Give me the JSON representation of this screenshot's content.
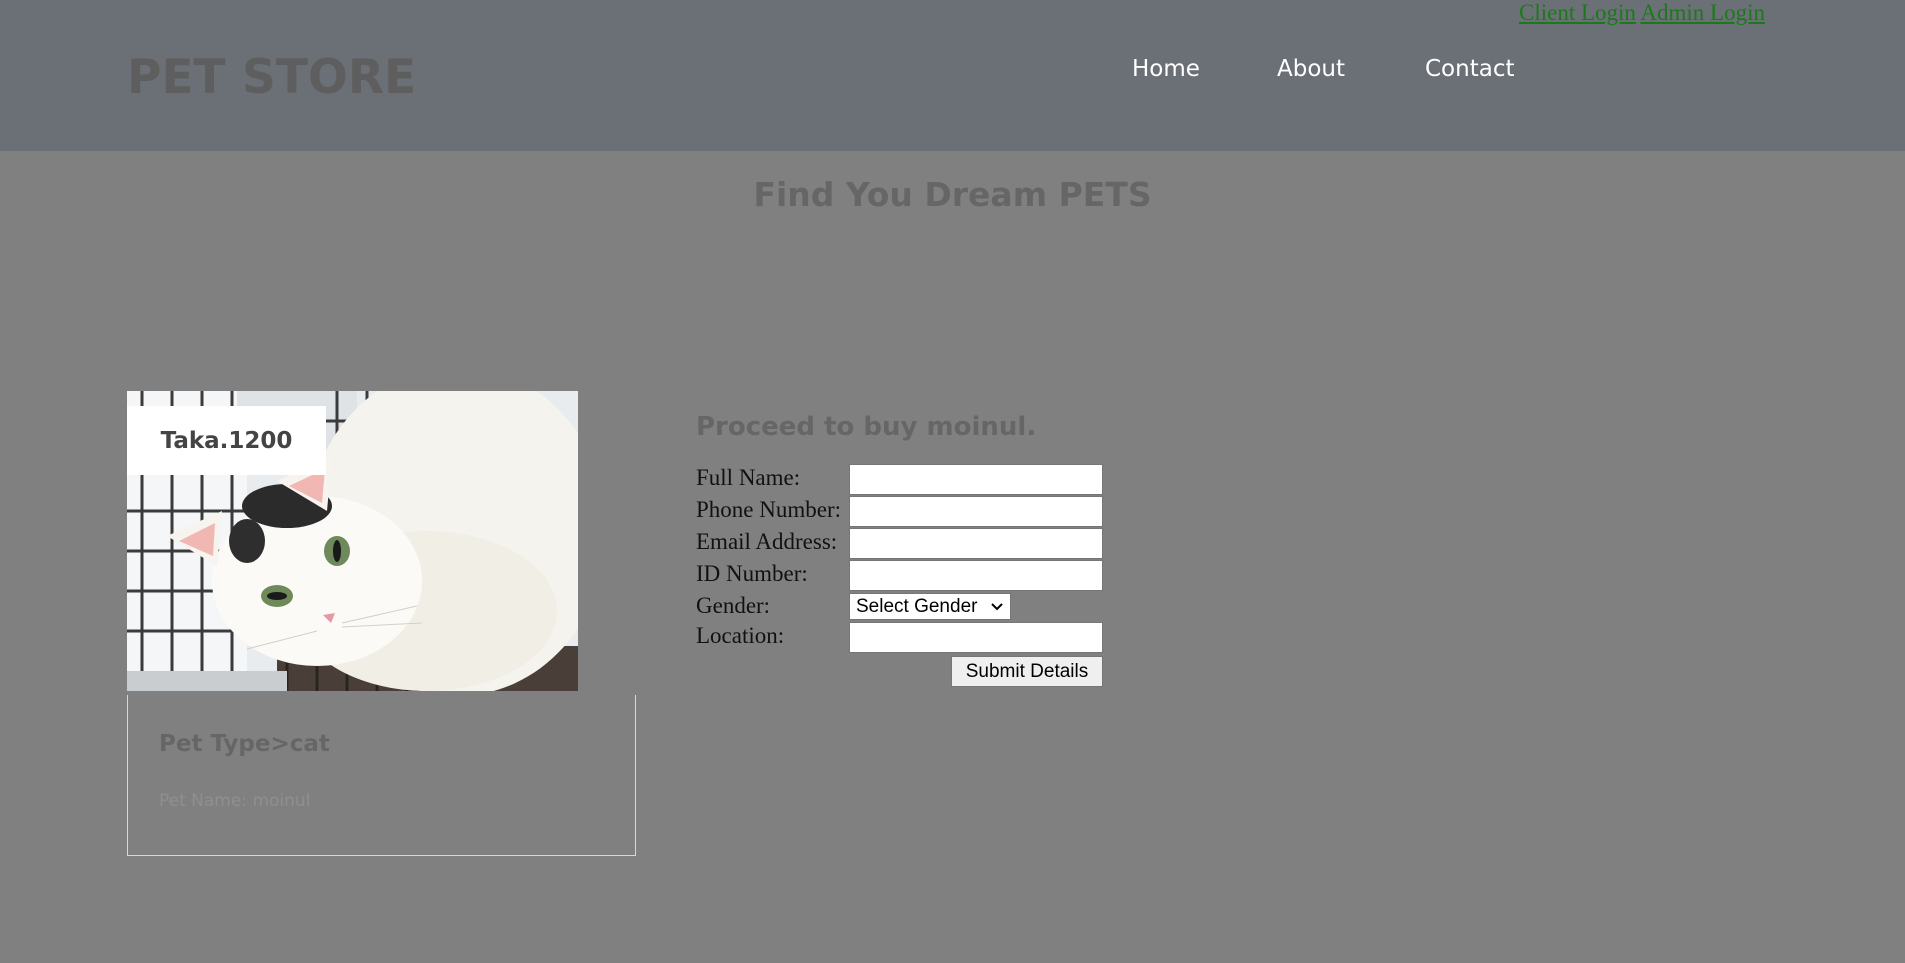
{
  "header": {
    "brand": "PET STORE",
    "top_links": [
      "Client Login",
      "Admin Login"
    ],
    "nav": [
      "Home",
      "About",
      "Contact"
    ]
  },
  "hero": {
    "title": "Find You Dream PETS"
  },
  "pet": {
    "price": "Taka.1200",
    "type_line": "Pet Type>cat",
    "name_line": "Pet Name: moinul"
  },
  "form": {
    "title": "Proceed to buy moinul.",
    "fields": [
      "Full Name:",
      "Phone Number:",
      "Email Address:",
      "ID Number:",
      "Gender:",
      "Location:"
    ],
    "gender_selected": "Select Gender",
    "submit_label": "Submit Details"
  },
  "colors": {
    "page_bg": "#808080",
    "header_bg": "#6b7077",
    "link_green": "#1a7a1a"
  }
}
